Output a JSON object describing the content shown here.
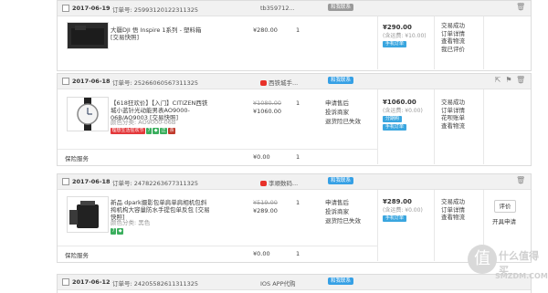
{
  "orders": [
    {
      "date": "2017-06-19",
      "order_no_label": "订单号: 25993120122311325",
      "shop": "tb359712...",
      "contact": "和我联系",
      "item": {
        "title": "大疆DJI 悟 Inspire 1系列 - 塑料箱 [交易快照]",
        "attr": "",
        "orig_price": "",
        "price": "¥280.00",
        "qty": "1"
      },
      "services": [],
      "total": {
        "amount": "¥290.00",
        "shipping": "(含运费: ¥10.00)",
        "pill": "手机订单"
      },
      "status": [
        "交易成功",
        "订单详情",
        "查看物流",
        "我已评价"
      ]
    },
    {
      "date": "2017-06-18",
      "order_no_label": "订单号: 25266060567311325",
      "shop": "西铁城手...",
      "contact": "和我联系",
      "item": {
        "title": "【618狂欢价】【入门】CITIZEN西铁城小蓝针光动能男表AO9000-06B/AO9003 [交易快照]",
        "attr": "颜色分类: AO9000-06B",
        "promo": "理想生活狂欢节",
        "orig_price": "¥1080.00",
        "price": "¥1060.00",
        "qty": "1"
      },
      "services": [
        "申请售后",
        "投诉商家",
        "退货险已失效"
      ],
      "total": {
        "amount": "¥1060.00",
        "shipping": "(含运费: ¥0.00)",
        "pill": "分期购",
        "pill2": "手机订单"
      },
      "status": [
        "交易成功",
        "订单详情",
        "花呗账单",
        "查看物流"
      ],
      "insurance": {
        "label": "保险服务",
        "price": "¥0.00",
        "qty": "1"
      }
    },
    {
      "date": "2017-06-18",
      "order_no_label": "订单号: 24782263677311325",
      "shop": "李顺数码...",
      "contact": "和我联系",
      "item": {
        "title": "新品 dpark摄影包单肩单肩相机包斜挎机构大容量防水手提包单反包 [交易快照]",
        "attr": "颜色分类: 黑色",
        "orig_price": "¥519.00",
        "price": "¥289.00",
        "qty": "1"
      },
      "services": [
        "申请售后",
        "投诉商家",
        "退货险已失效"
      ],
      "total": {
        "amount": "¥289.00",
        "shipping": "(含运费: ¥0.00)",
        "pill": "手机订单"
      },
      "status": [
        "交易成功",
        "订单详情",
        "查看物流"
      ],
      "actions": {
        "evaluate": "评价",
        "invoice": "开具申请"
      },
      "insurance": {
        "label": "保险服务",
        "price": "¥0.00",
        "qty": "1"
      }
    },
    {
      "date": "2017-06-12",
      "order_no_label": "订单号: 24205582611311325",
      "shop": "IOS APP代购",
      "contact": "和我联系"
    }
  ],
  "watermark": {
    "symbol": "值",
    "brand": "什么值得买",
    "site": "SMZDM.COM"
  }
}
